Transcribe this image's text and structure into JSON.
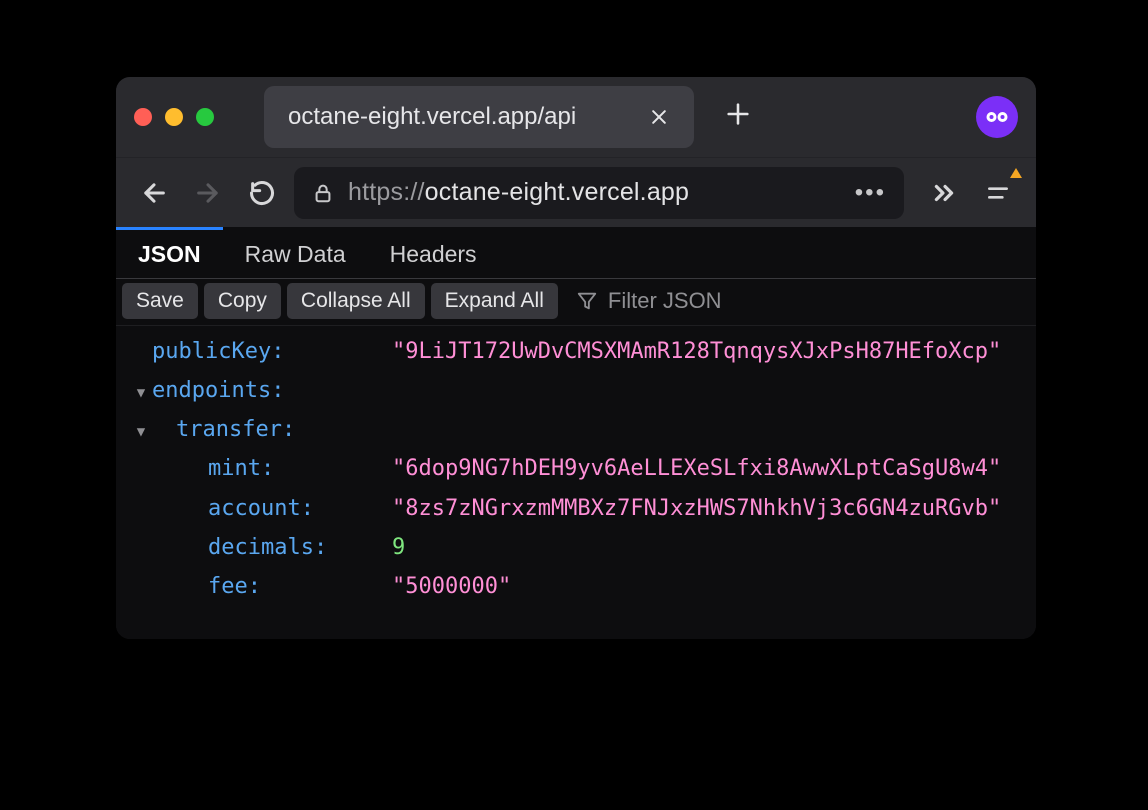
{
  "titlebar": {
    "tab_title": "octane-eight.vercel.app/api"
  },
  "addressbar": {
    "url_prefix": "https://",
    "url_host": "octane-eight.vercel.app",
    "url_rest": ""
  },
  "viewer_tabs": {
    "json": "JSON",
    "raw": "Raw Data",
    "headers": "Headers"
  },
  "toolbar": {
    "save": "Save",
    "copy": "Copy",
    "collapse_all": "Collapse All",
    "expand_all": "Expand All",
    "filter_placeholder": "Filter JSON"
  },
  "json": {
    "publicKey_label": "publicKey",
    "publicKey_value": "\"9LiJT172UwDvCMSXMAmR128TqnqysXJxPsH87HEfoXcp\"",
    "endpoints_label": "endpoints",
    "transfer_label": "transfer",
    "mint_label": "mint",
    "mint_value": "\"6dop9NG7hDEH9yv6AeLLEXeSLfxi8AwwXLptCaSgU8w4\"",
    "account_label": "account",
    "account_value": "\"8zs7zNGrxzmMMBXz7FNJxzHWS7NhkhVj3c6GN4zuRGvb\"",
    "decimals_label": "decimals",
    "decimals_value": "9",
    "fee_label": "fee",
    "fee_value": "\"5000000\""
  }
}
